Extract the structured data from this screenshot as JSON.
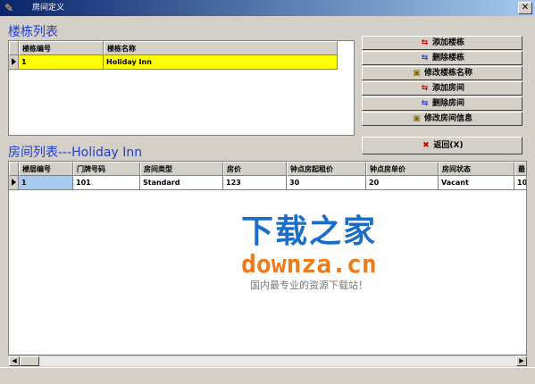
{
  "window": {
    "title": "房间定义",
    "close_glyph": "✕"
  },
  "buildings": {
    "section_title": "楼栋列表",
    "columns": [
      "楼栋编号",
      "楼栋名称"
    ],
    "rows": [
      [
        "1",
        "Holiday Inn"
      ]
    ],
    "selected_row_color": "#ffff00"
  },
  "rooms": {
    "section_title": "房间列表---Holiday Inn",
    "columns": [
      "楼层编号",
      "门牌号码",
      "房间类型",
      "房价",
      "钟点房起租价",
      "钟点房单价",
      "房间状态",
      "最"
    ],
    "rows": [
      [
        "1",
        "101",
        "Standard",
        "123",
        "30",
        "20",
        "Vacant",
        "10"
      ]
    ]
  },
  "actions": {
    "add_building": "添加楼栋",
    "delete_building": "删除楼栋",
    "rename_building": "修改楼栋名称",
    "add_room": "添加房间",
    "delete_room": "删除房间",
    "edit_room": "修改房间信息",
    "back": "返回(X)"
  },
  "watermark": {
    "cn": "下载之家",
    "en": "downza.cn",
    "tagline": "国内最专业的资源下载站！"
  },
  "colors": {
    "title_gradient_start": "#0a246a",
    "title_gradient_end": "#a6caf0",
    "section_title": "#1f3ccf"
  }
}
